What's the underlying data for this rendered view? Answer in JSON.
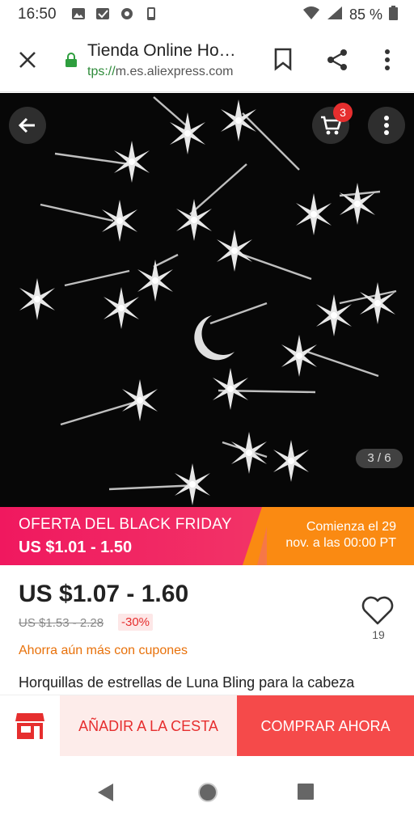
{
  "status": {
    "time": "16:50",
    "battery": "85 %"
  },
  "browser": {
    "title": "Tienda Online Ho…",
    "url_scheme": "tps://",
    "url_host": "m.es.aliexpress.com"
  },
  "gallery": {
    "cart_count": "3",
    "counter": "3 / 6"
  },
  "banner": {
    "title": "OFERTA DEL BLACK FRIDAY",
    "price": "US $1.01 - 1.50",
    "start_line1": "Comienza el 29",
    "start_line2": "nov. a las 00:00 PT"
  },
  "product": {
    "price": "US $1.07 - 1.60",
    "old_price": "US $1.53 - 2.28",
    "discount": "-30%",
    "coupon_text": "Ahorra aún más con cupones",
    "wish_count": "19",
    "title": "Horquillas de estrellas de Luna Bling para la cabeza"
  },
  "actions": {
    "add_to_cart": "AÑADIR A LA CESTA",
    "buy_now": "COMPRAR AHORA"
  },
  "colors": {
    "brand_red": "#e62e2e",
    "banner_pink": "#f0185f",
    "banner_orange": "#fa8a12",
    "coupon_orange": "#e8710a"
  }
}
